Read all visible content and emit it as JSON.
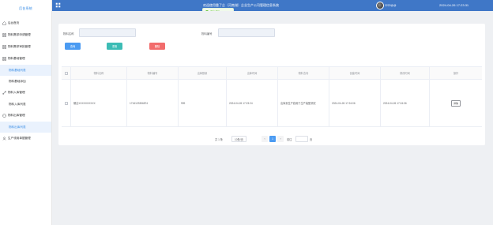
{
  "app": {
    "brand": "后台系统",
    "title": "欢迎使用重了企（河南湖）企业生产公司管理信息系统",
    "user": "2222@@",
    "clock": "2024-04-26 17:23:31"
  },
  "toast": {
    "text": "退出成功"
  },
  "sidebar": {
    "items": [
      {
        "label": "后台首页",
        "icon": "home-icon"
      },
      {
        "label": "物料需求申请管理",
        "icon": "grid-icon"
      },
      {
        "label": "物料需求审批管理",
        "icon": "grid-icon"
      },
      {
        "label": "物料基础管理",
        "icon": "grid-icon"
      },
      {
        "label": "物料基础列表",
        "sub": true,
        "active": true
      },
      {
        "label": "物料基础添加",
        "sub": true
      },
      {
        "label": "物料入库管理",
        "icon": "link-icon"
      },
      {
        "label": "物料入库列表",
        "sub": true
      },
      {
        "label": "物料出库管理",
        "icon": "chat-icon"
      },
      {
        "label": "物料出库列表",
        "sub": true,
        "active": true
      },
      {
        "label": "生产领用单据管理",
        "icon": "user-icon"
      }
    ]
  },
  "filters": {
    "name_label": "物料名称",
    "name_placeholder": "",
    "code_label": "物料编号",
    "code_placeholder": ""
  },
  "buttons": {
    "search": "查询",
    "reset": "重置",
    "delete": "删除"
  },
  "table": {
    "headers": [
      "物料名称",
      "物料编号",
      "出库数量",
      "出库时间",
      "物料去向",
      "创建时间",
      "修改时间",
      "操作"
    ],
    "rows": [
      {
        "name": "螺丝XXXXXXXXXX",
        "code": "1716123356874",
        "qty": "999",
        "out_time": "2024-04-26 17:23:24",
        "destination": "出库到生产线用于生产装配调试",
        "created": "2024-04-26 17:24:06",
        "modified": "2024-04-26 17:24:06",
        "action": "详情"
      }
    ]
  },
  "pager": {
    "total": "共 1 条",
    "size": "10条/页",
    "prev": "‹",
    "page": "1",
    "next": "›",
    "goto": "前往",
    "page_unit": "页"
  },
  "colors": {
    "header": "#3f77c7",
    "accent": "#3a8ee6",
    "search": "#4b9bf2",
    "reset": "#3dbcb5",
    "delete": "#f26c6c"
  }
}
